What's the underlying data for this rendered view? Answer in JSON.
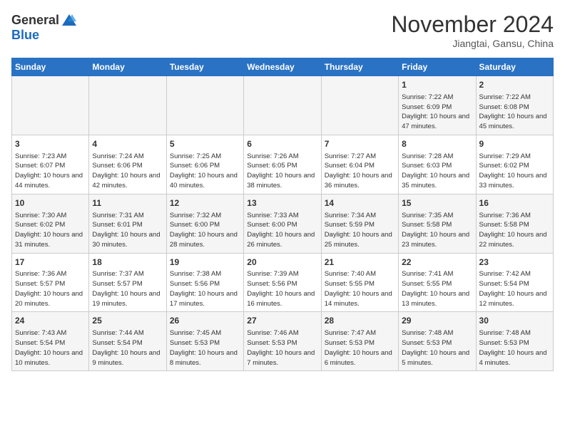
{
  "header": {
    "logo_general": "General",
    "logo_blue": "Blue",
    "month": "November 2024",
    "location": "Jiangtai, Gansu, China"
  },
  "days_of_week": [
    "Sunday",
    "Monday",
    "Tuesday",
    "Wednesday",
    "Thursday",
    "Friday",
    "Saturday"
  ],
  "weeks": [
    [
      {
        "day": "",
        "info": ""
      },
      {
        "day": "",
        "info": ""
      },
      {
        "day": "",
        "info": ""
      },
      {
        "day": "",
        "info": ""
      },
      {
        "day": "",
        "info": ""
      },
      {
        "day": "1",
        "info": "Sunrise: 7:22 AM\nSunset: 6:09 PM\nDaylight: 10 hours and 47 minutes."
      },
      {
        "day": "2",
        "info": "Sunrise: 7:22 AM\nSunset: 6:08 PM\nDaylight: 10 hours and 45 minutes."
      }
    ],
    [
      {
        "day": "3",
        "info": "Sunrise: 7:23 AM\nSunset: 6:07 PM\nDaylight: 10 hours and 44 minutes."
      },
      {
        "day": "4",
        "info": "Sunrise: 7:24 AM\nSunset: 6:06 PM\nDaylight: 10 hours and 42 minutes."
      },
      {
        "day": "5",
        "info": "Sunrise: 7:25 AM\nSunset: 6:06 PM\nDaylight: 10 hours and 40 minutes."
      },
      {
        "day": "6",
        "info": "Sunrise: 7:26 AM\nSunset: 6:05 PM\nDaylight: 10 hours and 38 minutes."
      },
      {
        "day": "7",
        "info": "Sunrise: 7:27 AM\nSunset: 6:04 PM\nDaylight: 10 hours and 36 minutes."
      },
      {
        "day": "8",
        "info": "Sunrise: 7:28 AM\nSunset: 6:03 PM\nDaylight: 10 hours and 35 minutes."
      },
      {
        "day": "9",
        "info": "Sunrise: 7:29 AM\nSunset: 6:02 PM\nDaylight: 10 hours and 33 minutes."
      }
    ],
    [
      {
        "day": "10",
        "info": "Sunrise: 7:30 AM\nSunset: 6:02 PM\nDaylight: 10 hours and 31 minutes."
      },
      {
        "day": "11",
        "info": "Sunrise: 7:31 AM\nSunset: 6:01 PM\nDaylight: 10 hours and 30 minutes."
      },
      {
        "day": "12",
        "info": "Sunrise: 7:32 AM\nSunset: 6:00 PM\nDaylight: 10 hours and 28 minutes."
      },
      {
        "day": "13",
        "info": "Sunrise: 7:33 AM\nSunset: 6:00 PM\nDaylight: 10 hours and 26 minutes."
      },
      {
        "day": "14",
        "info": "Sunrise: 7:34 AM\nSunset: 5:59 PM\nDaylight: 10 hours and 25 minutes."
      },
      {
        "day": "15",
        "info": "Sunrise: 7:35 AM\nSunset: 5:58 PM\nDaylight: 10 hours and 23 minutes."
      },
      {
        "day": "16",
        "info": "Sunrise: 7:36 AM\nSunset: 5:58 PM\nDaylight: 10 hours and 22 minutes."
      }
    ],
    [
      {
        "day": "17",
        "info": "Sunrise: 7:36 AM\nSunset: 5:57 PM\nDaylight: 10 hours and 20 minutes."
      },
      {
        "day": "18",
        "info": "Sunrise: 7:37 AM\nSunset: 5:57 PM\nDaylight: 10 hours and 19 minutes."
      },
      {
        "day": "19",
        "info": "Sunrise: 7:38 AM\nSunset: 5:56 PM\nDaylight: 10 hours and 17 minutes."
      },
      {
        "day": "20",
        "info": "Sunrise: 7:39 AM\nSunset: 5:56 PM\nDaylight: 10 hours and 16 minutes."
      },
      {
        "day": "21",
        "info": "Sunrise: 7:40 AM\nSunset: 5:55 PM\nDaylight: 10 hours and 14 minutes."
      },
      {
        "day": "22",
        "info": "Sunrise: 7:41 AM\nSunset: 5:55 PM\nDaylight: 10 hours and 13 minutes."
      },
      {
        "day": "23",
        "info": "Sunrise: 7:42 AM\nSunset: 5:54 PM\nDaylight: 10 hours and 12 minutes."
      }
    ],
    [
      {
        "day": "24",
        "info": "Sunrise: 7:43 AM\nSunset: 5:54 PM\nDaylight: 10 hours and 10 minutes."
      },
      {
        "day": "25",
        "info": "Sunrise: 7:44 AM\nSunset: 5:54 PM\nDaylight: 10 hours and 9 minutes."
      },
      {
        "day": "26",
        "info": "Sunrise: 7:45 AM\nSunset: 5:53 PM\nDaylight: 10 hours and 8 minutes."
      },
      {
        "day": "27",
        "info": "Sunrise: 7:46 AM\nSunset: 5:53 PM\nDaylight: 10 hours and 7 minutes."
      },
      {
        "day": "28",
        "info": "Sunrise: 7:47 AM\nSunset: 5:53 PM\nDaylight: 10 hours and 6 minutes."
      },
      {
        "day": "29",
        "info": "Sunrise: 7:48 AM\nSunset: 5:53 PM\nDaylight: 10 hours and 5 minutes."
      },
      {
        "day": "30",
        "info": "Sunrise: 7:48 AM\nSunset: 5:53 PM\nDaylight: 10 hours and 4 minutes."
      }
    ]
  ]
}
